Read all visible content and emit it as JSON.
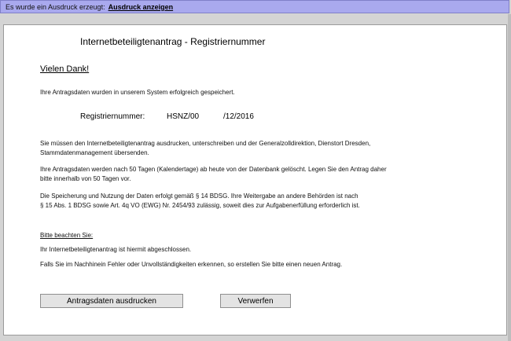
{
  "topbar": {
    "message": "Es wurde ein Ausdruck erzeugt:",
    "link": "Ausdruck anzeigen"
  },
  "page": {
    "title": "Internetbeteiligtenantrag - Registriernummer",
    "thanks": "Vielen Dank!",
    "saved_text": "Ihre Antragsdaten wurden in unserem System erfolgreich gespeichert.",
    "reg_label": "Registriernummer:",
    "reg_value1": "HSNZ/00",
    "reg_value2": "/12/2016",
    "para1_line1": "Sie müssen den Internetbeteiligtenantrag ausdrucken, unterschreiben und der Generalzolldirektion, Dienstort Dresden,",
    "para1_line2": "Stammdatenmanagement übersenden.",
    "para2_line1": "Ihre Antragsdaten werden nach 50 Tagen (Kalendertage) ab heute von der Datenbank gelöscht. Legen Sie den Antrag daher",
    "para2_line2": "bitte innerhalb von 50 Tagen vor.",
    "para3_line1": "Die Speicherung und Nutzung der Daten erfolgt gemäß § 14 BDSG. Ihre Weitergabe an andere Behörden ist nach",
    "para3_line2": "§ 15 Abs. 1 BDSG sowie Art. 4q VO (EWG) Nr. 2454/93 zulässig, soweit dies zur Aufgabenerfüllung erforderlich ist.",
    "notice_heading": "Bitte beachten Sie:",
    "notice1": "Ihr Internetbeteiligtenantrag ist hiermit abgeschlossen.",
    "notice2": "Falls Sie im Nachhinein Fehler oder Unvollständigkeiten erkennen, so erstellen Sie bitte einen neuen Antrag."
  },
  "buttons": {
    "print": "Antragsdaten ausdrucken",
    "discard": "Verwerfen"
  }
}
